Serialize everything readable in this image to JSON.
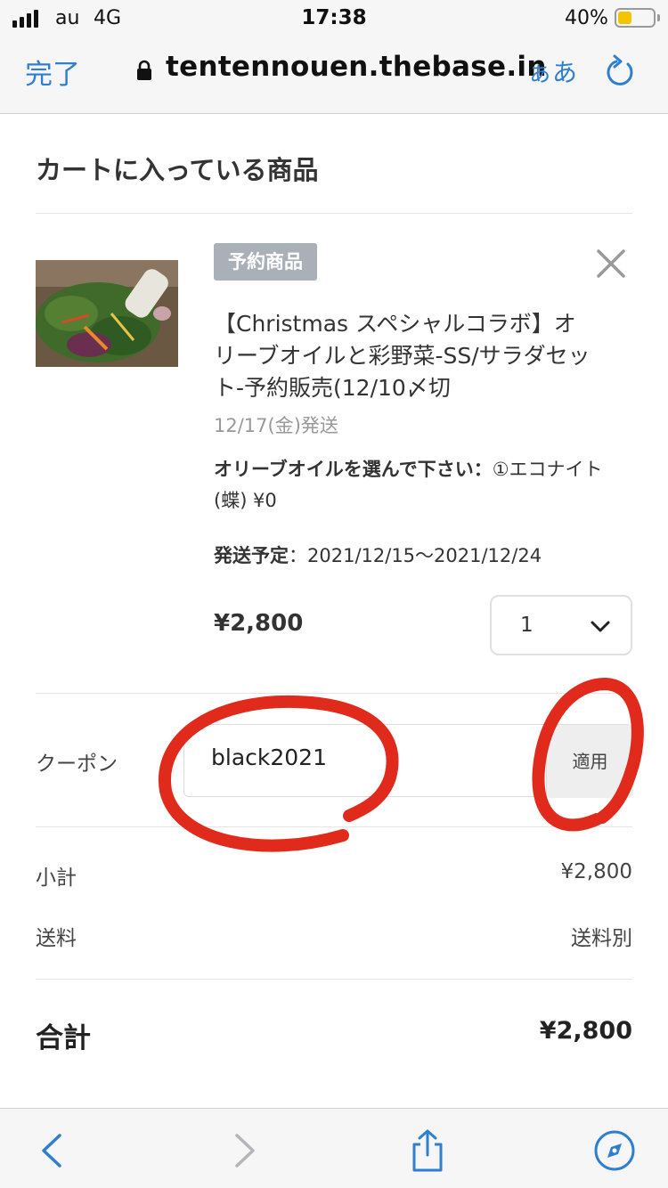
{
  "status_bar": {
    "carrier": "au",
    "network": "4G",
    "time": "17:38",
    "battery_percent": "40%",
    "battery_level": 0.4
  },
  "browser": {
    "done_label": "完了",
    "url": "tentennouen.thebase.in",
    "text_size_label": "ぁあ"
  },
  "cart": {
    "title": "カートに入っている商品",
    "item": {
      "badge": "予約商品",
      "name": "【Christmas スペシャルコラボ】オリーブオイルと彩野菜-SS/サラダセット-予約販売(12/10〆切",
      "ship_date": "12/17(金)発送",
      "option_label": "オリーブオイルを選んで下さい：",
      "option_value": "①エコナイト(蝶) ¥0",
      "schedule_label": "発送予定",
      "schedule_value": "：2021/12/15〜2021/12/24",
      "price": "¥2,800",
      "quantity": "1"
    },
    "coupon": {
      "label": "クーポン",
      "value": "black2021",
      "apply_label": "適用"
    },
    "subtotal": {
      "label": "小計",
      "value": "¥2,800"
    },
    "shipping": {
      "label": "送料",
      "value": "送料別"
    },
    "total": {
      "label": "合計",
      "value": "¥2,800"
    }
  },
  "colors": {
    "accent": "#2f7fd0",
    "badge": "#a9b0b8",
    "annotation": "#e02a1b"
  }
}
